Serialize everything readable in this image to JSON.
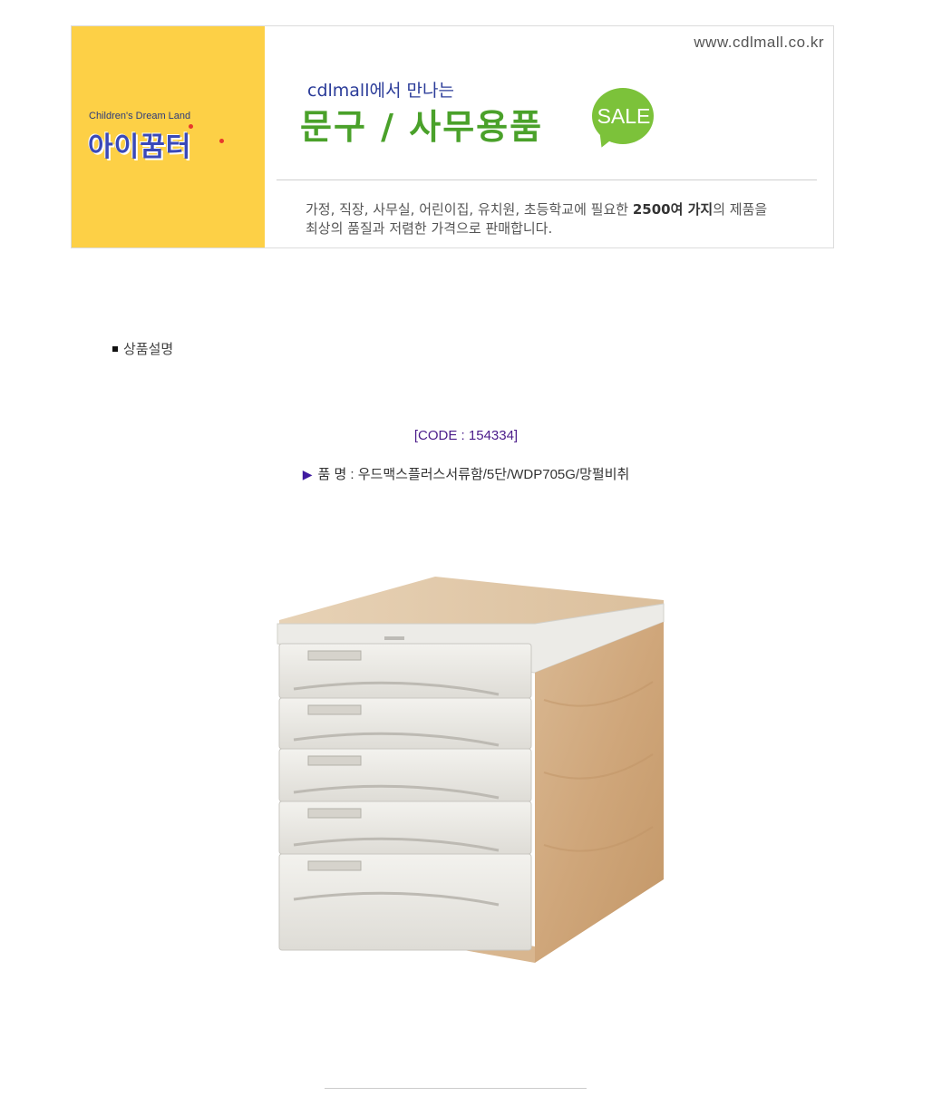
{
  "banner": {
    "brand_sub": "Children's Dream Land",
    "brand_name": "아이꿈터",
    "site_url": "www.cdlmall.co.kr",
    "tagline": "cdlmall에서 만나는",
    "headline": "문구 / 사무용품",
    "sale_badge": "SALE",
    "description_line1_pre": "가정, 직장, 사무실, 어린이집, 유치원, 초등학교에 필요한 ",
    "description_line1_bold": "2500여 가지",
    "description_line1_post": "의 제품을",
    "description_line2": "최상의 품질과 저렴한 가격으로 판매합니다."
  },
  "section": {
    "title": "상품설명"
  },
  "product": {
    "code": "[CODE : 154334]",
    "name_label": "품 명 : 우드맥스플러스서류함/5단/WDP705G/망펄비취",
    "arrow_icon": "play-triangle-icon"
  },
  "colors": {
    "brand_yellow": "#fdd046",
    "headline_green": "#4aa12a",
    "code_purple": "#4b1c8a"
  }
}
